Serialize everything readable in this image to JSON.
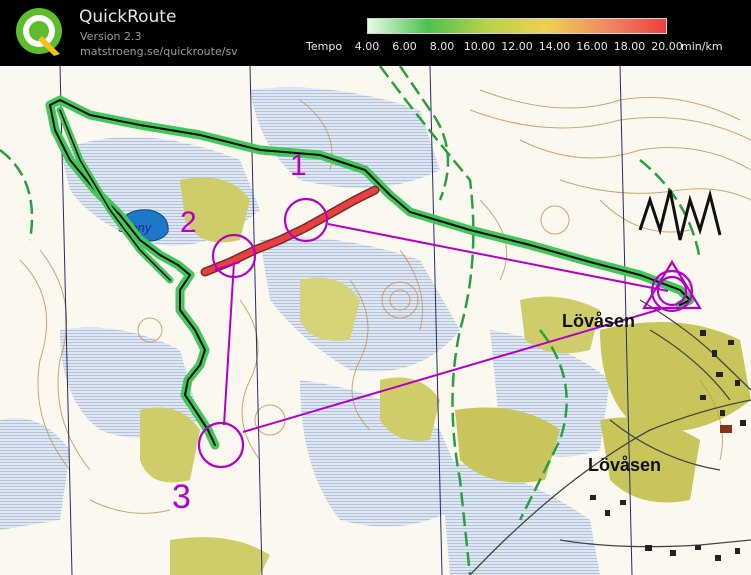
{
  "header": {
    "app_name": "QuickRoute",
    "version": "Version 2.3",
    "url": "matstroeng.se/quickroute/sv"
  },
  "legend": {
    "label": "Tempo",
    "unit": "min/km",
    "ticks": [
      "4.00",
      "6.00",
      "8.00",
      "10.00",
      "12.00",
      "14.00",
      "16.00",
      "18.00",
      "20.00"
    ],
    "gradient_colors": [
      "#e8fbe8",
      "#4cc24c",
      "#b8d24a",
      "#f0d050",
      "#f08a60",
      "#ee4040"
    ]
  },
  "map": {
    "lake_label": "Stony",
    "place_labels": [
      "Lövåsen",
      "Lövåsen"
    ],
    "control_numbers": [
      "1",
      "2",
      "3"
    ],
    "course_color": "#b400c8",
    "route_color": "#41c85a",
    "slow_route_color": "#e84040"
  }
}
